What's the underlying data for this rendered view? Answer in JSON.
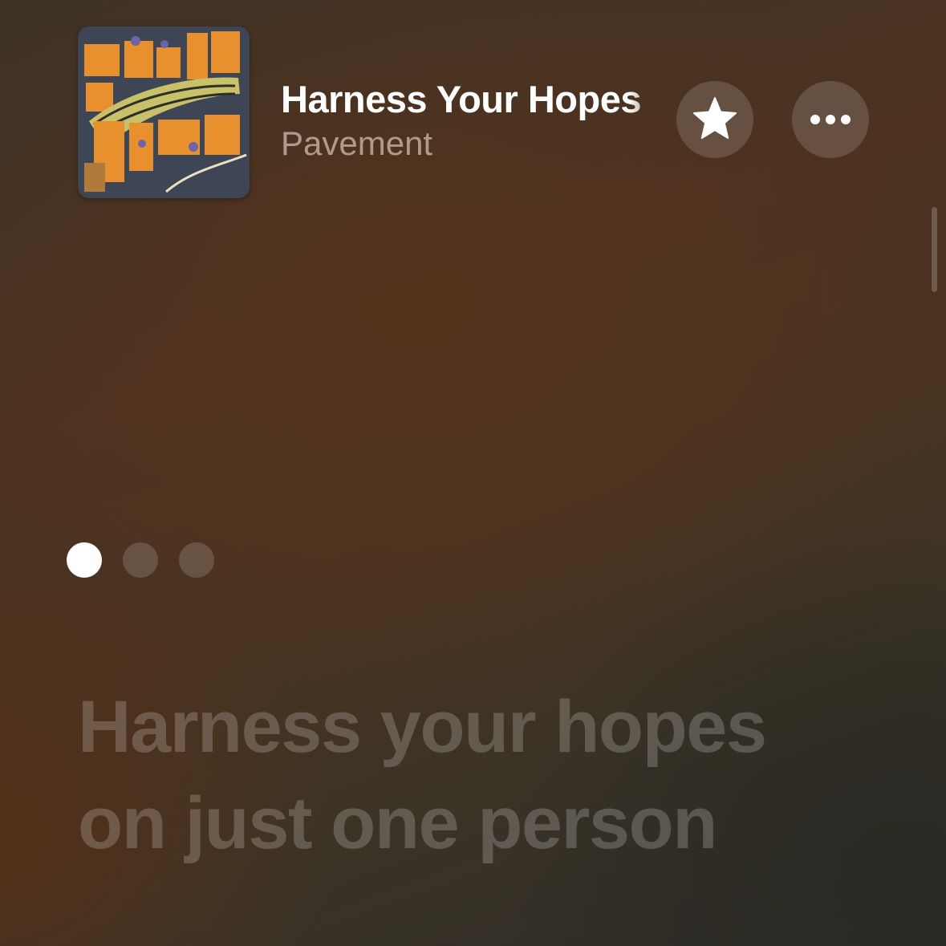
{
  "now_playing": {
    "title": "Harness Your Hopes",
    "artist": "Pavement",
    "artwork_icon": "album-artwork"
  },
  "actions": {
    "favorite_icon": "star-icon",
    "more_icon": "ellipsis-icon"
  },
  "pager": {
    "page_count": 3,
    "active_index": 0
  },
  "lyrics": {
    "lines": [
      "Harness your hopes",
      "on just one person"
    ]
  }
}
